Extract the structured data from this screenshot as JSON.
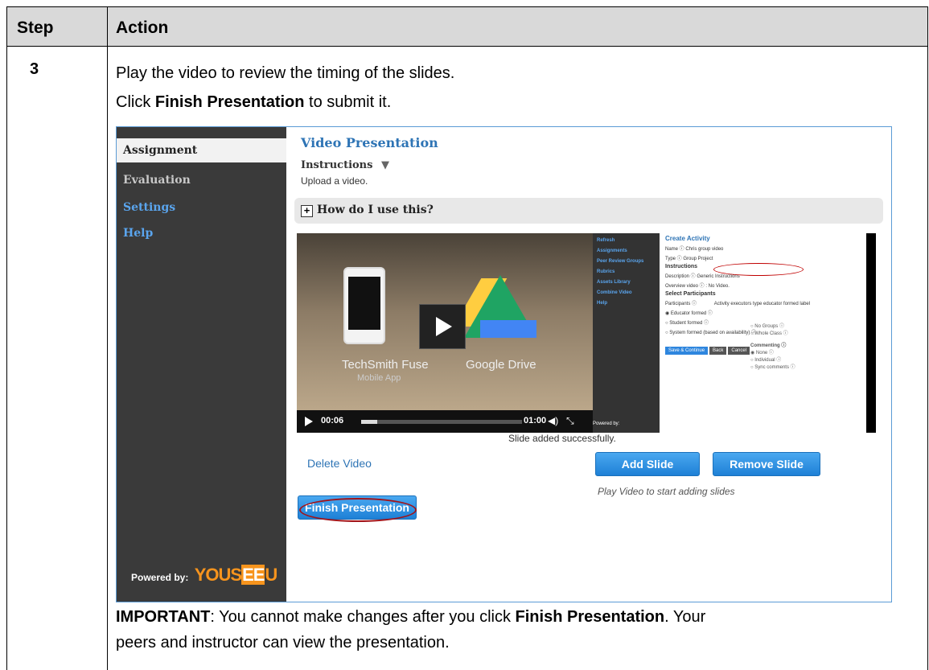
{
  "table": {
    "header_step": "Step",
    "header_action": "Action",
    "step_number": "3",
    "para1": "Play the video to review the timing of the slides.",
    "para2_prefix": "Click ",
    "para2_bold": "Finish Presentation",
    "para2_suffix": " to submit it.",
    "important_label": "IMPORTANT",
    "important_text1": ": You cannot make changes after you click ",
    "important_bold": "Finish Presentation",
    "important_text2": ". Your",
    "important_line2": "peers and instructor can view the presentation."
  },
  "screenshot": {
    "sidebar": {
      "items": [
        "Assignment",
        "Evaluation",
        "Settings",
        "Help"
      ],
      "powered_by": "Powered by:",
      "logo_pre": "YOUS",
      "logo_ee": "EE",
      "logo_post": "U"
    },
    "main": {
      "title": "Video Presentation",
      "instructions": "Instructions",
      "instructions_toggle": "▼",
      "upload_text": "Upload a video.",
      "how_label": "How do I use this?",
      "video": {
        "caption_left": "TechSmith Fuse",
        "caption_left_sub": "Mobile App",
        "caption_right": "Google Drive",
        "time_current": "00:06",
        "time_total": "01:00",
        "progress_fraction": 0.1
      },
      "slide": {
        "nav": [
          "Refresh",
          "Assignments",
          "Peer Review Groups",
          "Rubrics",
          "Assets Library",
          "Combine Video",
          "Help"
        ],
        "powered": "Powered by:",
        "title": "Create Activity",
        "name_line": "Name ⓘ Chris group video",
        "type_line": "Type ⓘ Group Project",
        "instructions_head": "Instructions",
        "description_line": "Description ⓘ Generic Instructions",
        "overview_line": "Overview video ⓘ : No Video.",
        "participants_head": "Select Participants",
        "participants_line": "Participants ⓘ",
        "participants_value": "Activity executors type educator formed label",
        "opt1": "◉ Educator formed ⓘ",
        "opt2": "○ Student formed ⓘ",
        "opt3": "○ System formed (based on availability) ⓘ",
        "right1": "○ No Groups ⓘ",
        "right2": "○ Whole Class ⓘ",
        "commenting": "Commenting ⓘ",
        "c1": "◉ None ⓘ",
        "c2": "○ Individual ⓘ",
        "c3": "○ Sync comments ⓘ",
        "btn_save": "Save & Continue",
        "btn_back": "Back",
        "btn_cancel": "Cancel"
      },
      "slide_added": "Slide added successfully.",
      "delete_video": "Delete Video",
      "add_slide": "Add Slide",
      "remove_slide": "Remove Slide",
      "play_hint": "Play Video to start adding slides",
      "finish": "Finish Presentation"
    },
    "colors": {
      "accent": "#2e74b5",
      "sidebar": "#3a3a3a",
      "annotation": "#a1141a"
    }
  }
}
